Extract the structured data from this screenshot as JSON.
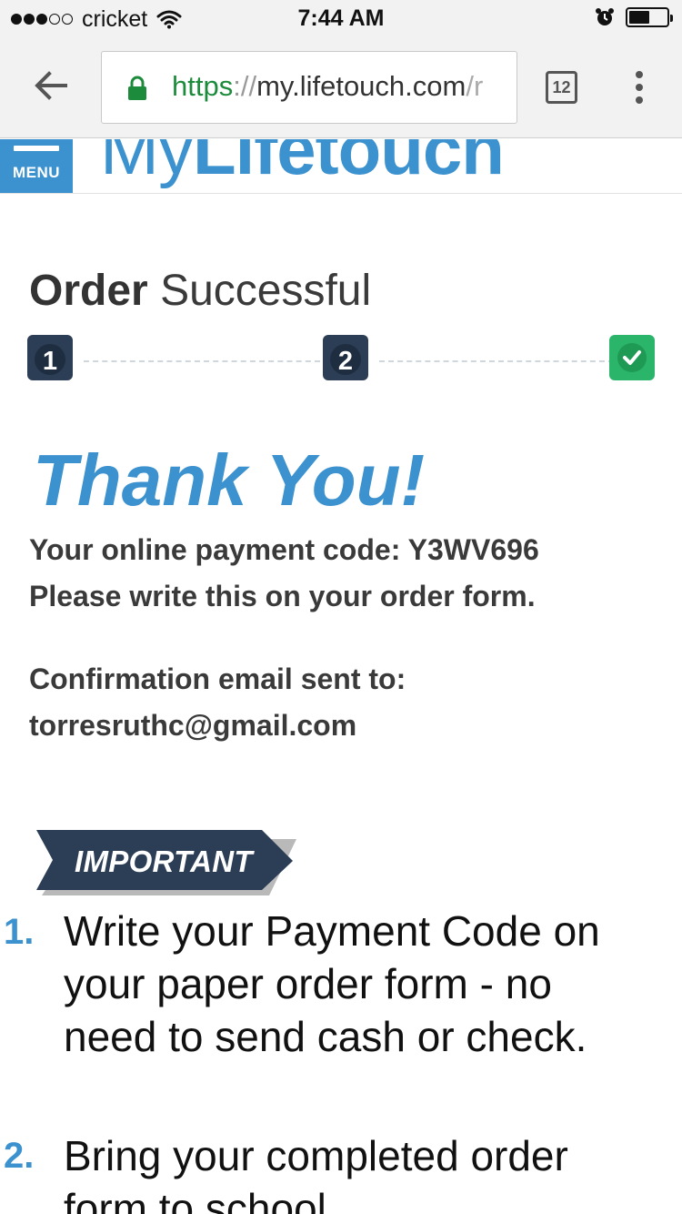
{
  "status_bar": {
    "carrier": "cricket",
    "signal_bars_filled": 3,
    "signal_bars_total": 5,
    "time": "7:44 AM",
    "battery_level": 0.55
  },
  "browser": {
    "url_scheme": "https",
    "url_separator": "://",
    "url_host": "my.lifetouch.com",
    "url_rest": "/r",
    "tab_count": "12"
  },
  "site_header": {
    "menu_label": "MENU",
    "logo_part1": "My",
    "logo_part2": "Lifetouch"
  },
  "order": {
    "title_bold": "Order",
    "title_light": "Successful",
    "steps": [
      "1",
      "2"
    ],
    "thank_you": "Thank You!",
    "payment_code_line": "Your online payment code: Y3WV696",
    "write_line": "Please write this on your order form.",
    "confirmation_label": "Confirmation email sent to:",
    "email": "torresruthc@gmail.com"
  },
  "important": {
    "banner": "IMPORTANT",
    "items": [
      {
        "number": "1.",
        "lines": [
          "Write your Payment Code on",
          "your paper order form - no",
          "need to send cash or check."
        ]
      },
      {
        "number": "2.",
        "lines": [
          "Bring your completed order",
          "form to school."
        ]
      }
    ]
  },
  "colors": {
    "brand_blue": "#3c92cf",
    "step_navy": "#2c3e55",
    "success_green": "#2bb56b",
    "url_green": "#1c8b3c"
  },
  "icons": {
    "back": "back-arrow-icon",
    "lock": "lock-icon",
    "wifi": "wifi-icon",
    "alarm": "alarm-icon",
    "battery": "battery-icon",
    "check": "check-icon",
    "more": "more-vert-icon",
    "menu": "hamburger-icon"
  }
}
